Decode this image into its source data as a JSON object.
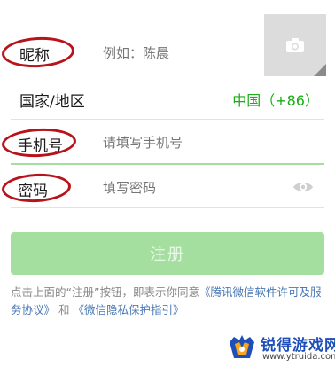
{
  "form": {
    "nickname": {
      "label": "昵称",
      "placeholder": "例如：陈晨"
    },
    "region": {
      "label": "国家/地区",
      "value": "中国（+86）"
    },
    "phone": {
      "label": "手机号",
      "placeholder": "请填写手机号"
    },
    "password": {
      "label": "密码",
      "placeholder": "填写密码"
    }
  },
  "avatar": {
    "icon": "camera-icon"
  },
  "register_button": "注册",
  "agreement": {
    "prefix": "点击上面的“注册”按钮，即表示你同意",
    "link1": "《腾讯微信软件许可及服务协议》",
    "middle": "和",
    "link2": "《微信隐私保护指引》"
  },
  "watermark": {
    "title": "锐得游戏网",
    "url": "www.ytruida.com"
  },
  "colors": {
    "accent_green": "#1aad19",
    "button_disabled": "#a5dfa0",
    "annotation_red": "#b8131a",
    "link_blue": "#4a78b4"
  }
}
